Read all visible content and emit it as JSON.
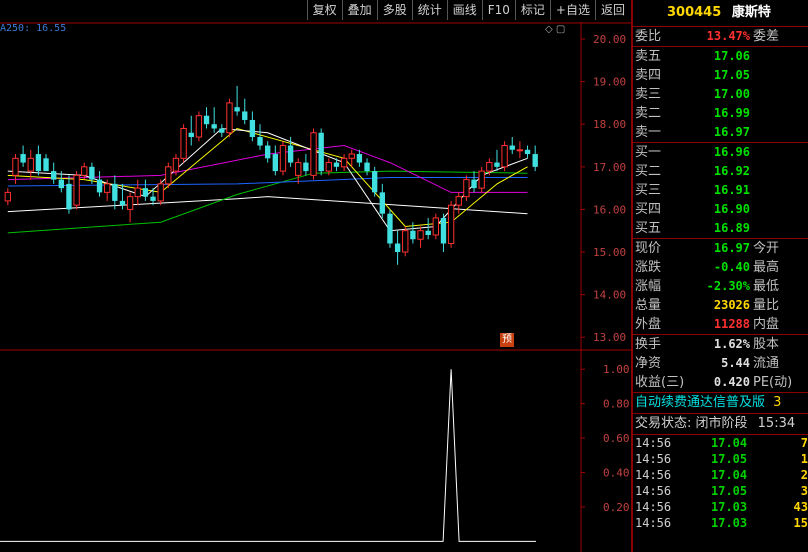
{
  "toolbar": [
    "复权",
    "叠加",
    "多股",
    "统计",
    "画线",
    "F10",
    "标记",
    "+自选",
    "返回"
  ],
  "chart_data": [
    {
      "type": "candlestick",
      "indicator_label": "A250: 16.55",
      "y_axis_ticks": [
        "20.00",
        "19.00",
        "18.00",
        "17.00",
        "16.00",
        "15.00",
        "14.00",
        "13.00"
      ],
      "ylim": [
        12.7,
        20.4
      ],
      "pre_marker": "预",
      "candles": [
        {
          "o": 16.2,
          "h": 16.5,
          "l": 16.1,
          "c": 16.4
        },
        {
          "o": 16.8,
          "h": 17.3,
          "l": 16.6,
          "c": 17.2
        },
        {
          "o": 17.3,
          "h": 17.5,
          "l": 17.0,
          "c": 17.1
        },
        {
          "o": 16.9,
          "h": 17.4,
          "l": 16.7,
          "c": 17.2
        },
        {
          "o": 17.3,
          "h": 17.5,
          "l": 16.8,
          "c": 16.9
        },
        {
          "o": 17.2,
          "h": 17.3,
          "l": 16.9,
          "c": 16.9
        },
        {
          "o": 16.9,
          "h": 17.1,
          "l": 16.6,
          "c": 16.7
        },
        {
          "o": 16.7,
          "h": 16.9,
          "l": 16.4,
          "c": 16.5
        },
        {
          "o": 16.6,
          "h": 16.8,
          "l": 15.9,
          "c": 16.0
        },
        {
          "o": 16.1,
          "h": 16.9,
          "l": 16.0,
          "c": 16.8
        },
        {
          "o": 16.8,
          "h": 17.1,
          "l": 16.7,
          "c": 17.0
        },
        {
          "o": 17.0,
          "h": 17.1,
          "l": 16.6,
          "c": 16.7
        },
        {
          "o": 16.7,
          "h": 16.9,
          "l": 16.3,
          "c": 16.4
        },
        {
          "o": 16.4,
          "h": 16.7,
          "l": 16.2,
          "c": 16.6
        },
        {
          "o": 16.6,
          "h": 16.8,
          "l": 16.0,
          "c": 16.2
        },
        {
          "o": 16.2,
          "h": 16.6,
          "l": 16.0,
          "c": 16.1
        },
        {
          "o": 16.0,
          "h": 16.4,
          "l": 15.7,
          "c": 16.3
        },
        {
          "o": 16.3,
          "h": 16.7,
          "l": 16.1,
          "c": 16.5
        },
        {
          "o": 16.5,
          "h": 16.7,
          "l": 16.2,
          "c": 16.3
        },
        {
          "o": 16.3,
          "h": 16.5,
          "l": 16.1,
          "c": 16.2
        },
        {
          "o": 16.2,
          "h": 16.7,
          "l": 16.1,
          "c": 16.6
        },
        {
          "o": 16.6,
          "h": 17.1,
          "l": 16.5,
          "c": 17.0
        },
        {
          "o": 16.9,
          "h": 17.3,
          "l": 16.8,
          "c": 17.2
        },
        {
          "o": 17.2,
          "h": 18.0,
          "l": 17.1,
          "c": 17.9
        },
        {
          "o": 17.8,
          "h": 18.2,
          "l": 17.5,
          "c": 17.7
        },
        {
          "o": 17.7,
          "h": 18.3,
          "l": 17.6,
          "c": 18.2
        },
        {
          "o": 18.2,
          "h": 18.4,
          "l": 17.9,
          "c": 18.0
        },
        {
          "o": 18.0,
          "h": 18.4,
          "l": 17.8,
          "c": 17.9
        },
        {
          "o": 17.9,
          "h": 18.0,
          "l": 17.7,
          "c": 17.8
        },
        {
          "o": 17.8,
          "h": 18.6,
          "l": 17.7,
          "c": 18.5
        },
        {
          "o": 18.4,
          "h": 18.9,
          "l": 18.2,
          "c": 18.3
        },
        {
          "o": 18.3,
          "h": 18.6,
          "l": 18.0,
          "c": 18.1
        },
        {
          "o": 18.1,
          "h": 18.3,
          "l": 17.6,
          "c": 17.7
        },
        {
          "o": 17.7,
          "h": 18.0,
          "l": 17.4,
          "c": 17.5
        },
        {
          "o": 17.5,
          "h": 17.6,
          "l": 17.1,
          "c": 17.2
        },
        {
          "o": 17.3,
          "h": 17.5,
          "l": 16.8,
          "c": 16.9
        },
        {
          "o": 16.9,
          "h": 17.6,
          "l": 16.8,
          "c": 17.5
        },
        {
          "o": 17.5,
          "h": 17.7,
          "l": 17.0,
          "c": 17.1
        },
        {
          "o": 16.8,
          "h": 17.2,
          "l": 16.6,
          "c": 17.1
        },
        {
          "o": 17.1,
          "h": 17.3,
          "l": 16.8,
          "c": 16.9
        },
        {
          "o": 16.8,
          "h": 17.9,
          "l": 16.7,
          "c": 17.8
        },
        {
          "o": 17.8,
          "h": 17.9,
          "l": 16.8,
          "c": 16.9
        },
        {
          "o": 16.9,
          "h": 17.2,
          "l": 16.8,
          "c": 17.1
        },
        {
          "o": 17.1,
          "h": 17.2,
          "l": 16.9,
          "c": 17.0
        },
        {
          "o": 17.0,
          "h": 17.3,
          "l": 16.9,
          "c": 17.2
        },
        {
          "o": 17.2,
          "h": 17.4,
          "l": 17.0,
          "c": 17.3
        },
        {
          "o": 17.3,
          "h": 17.4,
          "l": 17.0,
          "c": 17.1
        },
        {
          "o": 17.1,
          "h": 17.2,
          "l": 16.8,
          "c": 16.9
        },
        {
          "o": 16.9,
          "h": 17.0,
          "l": 16.3,
          "c": 16.4
        },
        {
          "o": 16.4,
          "h": 16.6,
          "l": 15.8,
          "c": 15.9
        },
        {
          "o": 15.9,
          "h": 16.0,
          "l": 15.1,
          "c": 15.2
        },
        {
          "o": 15.2,
          "h": 15.5,
          "l": 14.7,
          "c": 15.0
        },
        {
          "o": 15.0,
          "h": 15.6,
          "l": 14.9,
          "c": 15.5
        },
        {
          "o": 15.5,
          "h": 15.7,
          "l": 15.2,
          "c": 15.3
        },
        {
          "o": 15.3,
          "h": 15.6,
          "l": 15.1,
          "c": 15.5
        },
        {
          "o": 15.5,
          "h": 15.8,
          "l": 15.3,
          "c": 15.4
        },
        {
          "o": 15.4,
          "h": 15.9,
          "l": 15.3,
          "c": 15.8
        },
        {
          "o": 15.8,
          "h": 15.9,
          "l": 15.0,
          "c": 15.2
        },
        {
          "o": 15.2,
          "h": 16.2,
          "l": 15.1,
          "c": 16.1
        },
        {
          "o": 16.1,
          "h": 16.4,
          "l": 15.9,
          "c": 16.3
        },
        {
          "o": 16.3,
          "h": 16.8,
          "l": 16.2,
          "c": 16.7
        },
        {
          "o": 16.7,
          "h": 16.9,
          "l": 16.4,
          "c": 16.5
        },
        {
          "o": 16.5,
          "h": 17.0,
          "l": 16.4,
          "c": 16.9
        },
        {
          "o": 16.9,
          "h": 17.2,
          "l": 16.8,
          "c": 17.1
        },
        {
          "o": 17.1,
          "h": 17.4,
          "l": 16.9,
          "c": 17.0
        },
        {
          "o": 17.0,
          "h": 17.6,
          "l": 16.9,
          "c": 17.5
        },
        {
          "o": 17.5,
          "h": 17.7,
          "l": 17.3,
          "c": 17.4
        },
        {
          "o": 17.4,
          "h": 17.6,
          "l": 17.2,
          "c": 17.4
        },
        {
          "o": 17.4,
          "h": 17.5,
          "l": 17.2,
          "c": 17.3
        },
        {
          "o": 17.3,
          "h": 17.5,
          "l": 16.9,
          "c": 17.0
        }
      ],
      "ma_lines": [
        {
          "color": "#ffffff",
          "points": [
            [
              0,
              15.95
            ],
            [
              30,
              16.25
            ],
            [
              34,
              16.3
            ],
            [
              68,
              15.9
            ]
          ]
        },
        {
          "color": "#00c000",
          "points": [
            [
              0,
              15.45
            ],
            [
              20,
              15.7
            ],
            [
              30,
              16.35
            ],
            [
              40,
              16.85
            ],
            [
              50,
              16.9
            ],
            [
              68,
              16.85
            ]
          ]
        },
        {
          "color": "#1e64ff",
          "points": [
            [
              0,
              16.55
            ],
            [
              30,
              16.6
            ],
            [
              50,
              16.75
            ],
            [
              68,
              16.75
            ]
          ]
        },
        {
          "color": "#e000e0",
          "points": [
            [
              0,
              16.7
            ],
            [
              20,
              16.8
            ],
            [
              34,
              17.3
            ],
            [
              44,
              17.5
            ],
            [
              50,
              17.1
            ],
            [
              58,
              16.4
            ],
            [
              68,
              16.4
            ]
          ]
        },
        {
          "color": "#ffff00",
          "points": [
            [
              0,
              16.8
            ],
            [
              10,
              16.7
            ],
            [
              20,
              16.4
            ],
            [
              30,
              17.9
            ],
            [
              36,
              17.6
            ],
            [
              44,
              17.2
            ],
            [
              52,
              15.6
            ],
            [
              58,
              15.7
            ],
            [
              64,
              16.6
            ],
            [
              68,
              17.0
            ]
          ]
        },
        {
          "color": "#ffffff",
          "points": [
            [
              0,
              16.9
            ],
            [
              10,
              16.8
            ],
            [
              18,
              16.3
            ],
            [
              28,
              17.9
            ],
            [
              34,
              17.8
            ],
            [
              44,
              17.1
            ],
            [
              50,
              15.5
            ],
            [
              56,
              15.6
            ],
            [
              62,
              16.8
            ],
            [
              68,
              17.2
            ]
          ]
        }
      ]
    },
    {
      "type": "line",
      "y_axis_ticks": [
        "1.00",
        "0.80",
        "0.60",
        "0.40",
        "0.20"
      ],
      "ylim": [
        -0.05,
        1.1
      ],
      "spike": {
        "index": 58,
        "value": 1.0
      }
    }
  ],
  "panel": {
    "code": "300445",
    "name": "康斯特",
    "weibi_label": "委比",
    "weibi_value": "13.47%",
    "weicha_label": "委差",
    "sell": [
      {
        "label": "卖五",
        "price": "17.06"
      },
      {
        "label": "卖四",
        "price": "17.05"
      },
      {
        "label": "卖三",
        "price": "17.00"
      },
      {
        "label": "卖二",
        "price": "16.99"
      },
      {
        "label": "卖一",
        "price": "16.97"
      }
    ],
    "buy": [
      {
        "label": "买一",
        "price": "16.96"
      },
      {
        "label": "买二",
        "price": "16.92"
      },
      {
        "label": "买三",
        "price": "16.91"
      },
      {
        "label": "买四",
        "price": "16.90"
      },
      {
        "label": "买五",
        "price": "16.89"
      }
    ],
    "stats": [
      {
        "label": "现价",
        "value": "16.97",
        "label2": "今开",
        "color": "#00e000"
      },
      {
        "label": "涨跌",
        "value": "-0.40",
        "label2": "最高",
        "color": "#00e000"
      },
      {
        "label": "涨幅",
        "value": "-2.30%",
        "label2": "最低",
        "color": "#00e000"
      },
      {
        "label": "总量",
        "value": "23026",
        "label2": "量比",
        "color": "#ffd700"
      },
      {
        "label": "外盘",
        "value": "11288",
        "label2": "内盘",
        "color": "#ff3030"
      }
    ],
    "stats2": [
      {
        "label": "换手",
        "value": "1.62%",
        "label2": "股本",
        "color": "#e0e0e0"
      },
      {
        "label": "净资",
        "value": "5.44",
        "label2": "流通",
        "color": "#e0e0e0"
      },
      {
        "label": "收益(三)",
        "value": "0.420",
        "label2": "PE(动)",
        "color": "#e0e0e0"
      }
    ],
    "marquee": "自动续费通达信普及版",
    "marquee_num": "3",
    "trade_status": "交易状态: 闭市阶段",
    "trade_time": "15:34",
    "ticks": [
      {
        "time": "14:56",
        "price": "17.04",
        "vol": "7"
      },
      {
        "time": "14:56",
        "price": "17.05",
        "vol": "1"
      },
      {
        "time": "14:56",
        "price": "17.04",
        "vol": "2"
      },
      {
        "time": "14:56",
        "price": "17.05",
        "vol": "3"
      },
      {
        "time": "14:56",
        "price": "17.03",
        "vol": "43"
      },
      {
        "time": "14:56",
        "price": "17.03",
        "vol": "15"
      }
    ]
  }
}
